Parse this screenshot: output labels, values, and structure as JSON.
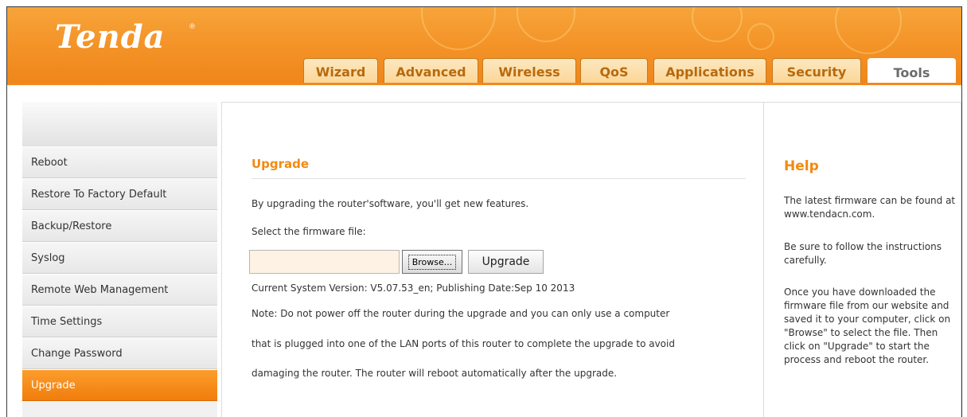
{
  "brand": {
    "logo": "Tenda",
    "reg": "®"
  },
  "tabs": [
    {
      "label": "Wizard"
    },
    {
      "label": "Advanced"
    },
    {
      "label": "Wireless"
    },
    {
      "label": "QoS"
    },
    {
      "label": "Applications"
    },
    {
      "label": "Security"
    },
    {
      "label": "Tools"
    }
  ],
  "sidebar": {
    "items": [
      {
        "label": "Reboot"
      },
      {
        "label": "Restore To Factory Default"
      },
      {
        "label": "Backup/Restore"
      },
      {
        "label": "Syslog"
      },
      {
        "label": "Remote Web Management"
      },
      {
        "label": "Time Settings"
      },
      {
        "label": "Change Password"
      },
      {
        "label": "Upgrade"
      }
    ]
  },
  "main": {
    "title": "Upgrade",
    "intro": "By upgrading the router'software, you'll get new features.",
    "select_label": "Select the firmware file:",
    "file_value": "",
    "browse_label": "Browse...",
    "upgrade_label": "Upgrade",
    "version": "Current System Version: V5.07.53_en; Publishing Date:Sep 10 2013",
    "note_line1": "Note: Do not power off the router during the upgrade and you can only use a computer",
    "note_line2": "that is plugged into one of the LAN ports of this router to complete the upgrade to avoid",
    "note_line3": "damaging the router. The router will reboot automatically after the upgrade."
  },
  "help": {
    "title": "Help",
    "p1": "The latest firmware can be found at www.tendacn.com.",
    "p2": "Be sure to follow the instructions carefully.",
    "p3": "Once you have downloaded the firmware file from our website and saved it to your computer, click on \"Browse\" to select the file. Then click on \"Upgrade\" to start the process and reboot the router."
  },
  "colors": {
    "accent": "#f28a0f",
    "header_orange": "#f39226",
    "tab_bg": "#fbd596",
    "tab_text": "#b76a0d"
  }
}
